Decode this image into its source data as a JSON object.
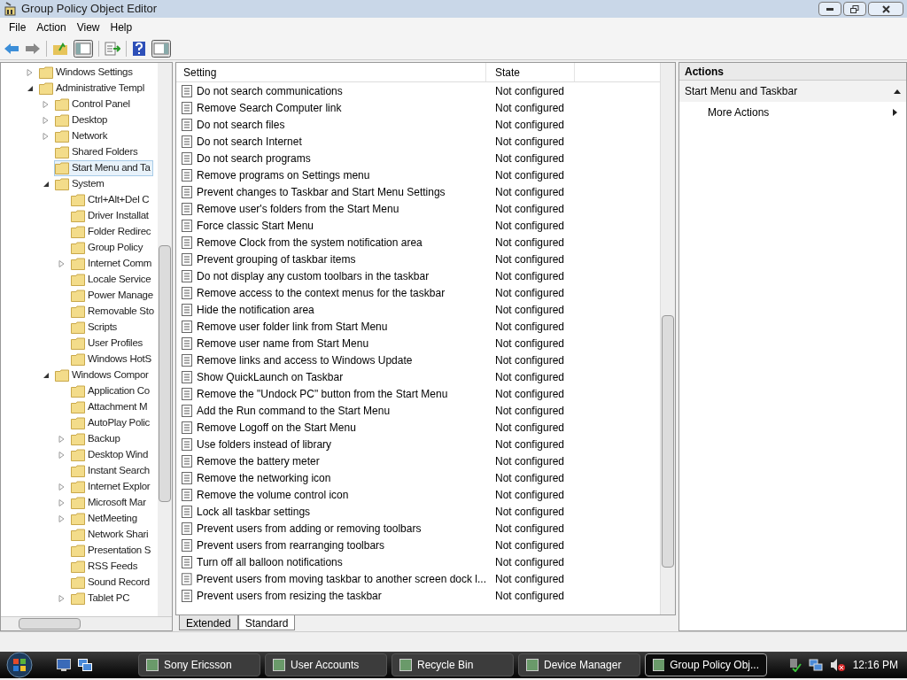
{
  "window": {
    "title": "Group Policy Object Editor"
  },
  "menu": [
    "File",
    "Action",
    "View",
    "Help"
  ],
  "tree": [
    {
      "label": "Windows Settings",
      "kind": "branch",
      "expanded": false,
      "selected": false
    },
    {
      "label": "Administrative Templ",
      "kind": "branch",
      "expanded": true,
      "selected": false,
      "children": [
        {
          "label": "Control Panel",
          "kind": "branch",
          "expanded": false,
          "selected": false
        },
        {
          "label": "Desktop",
          "kind": "branch",
          "expanded": false,
          "selected": false
        },
        {
          "label": "Network",
          "kind": "branch",
          "expanded": false,
          "selected": false
        },
        {
          "label": "Shared Folders",
          "kind": "leaf",
          "selected": false
        },
        {
          "label": "Start Menu and Ta",
          "kind": "leaf",
          "selected": true
        },
        {
          "label": "System",
          "kind": "branch",
          "expanded": true,
          "selected": false,
          "children": [
            {
              "label": "Ctrl+Alt+Del C",
              "kind": "leaf",
              "selected": false
            },
            {
              "label": "Driver Installat",
              "kind": "leaf",
              "selected": false
            },
            {
              "label": "Folder Redirec",
              "kind": "leaf",
              "selected": false
            },
            {
              "label": "Group Policy",
              "kind": "leaf",
              "selected": false
            },
            {
              "label": "Internet Comm",
              "kind": "branch",
              "expanded": false,
              "selected": false
            },
            {
              "label": "Locale Service",
              "kind": "leaf",
              "selected": false
            },
            {
              "label": "Power Manage",
              "kind": "leaf",
              "selected": false
            },
            {
              "label": "Removable Sto",
              "kind": "leaf",
              "selected": false
            },
            {
              "label": "Scripts",
              "kind": "leaf",
              "selected": false
            },
            {
              "label": "User Profiles",
              "kind": "leaf",
              "selected": false
            },
            {
              "label": "Windows HotS",
              "kind": "leaf",
              "selected": false
            }
          ]
        },
        {
          "label": "Windows Compor",
          "kind": "branch",
          "expanded": true,
          "selected": false,
          "children": [
            {
              "label": "Application Co",
              "kind": "leaf",
              "selected": false
            },
            {
              "label": "Attachment M",
              "kind": "leaf",
              "selected": false
            },
            {
              "label": "AutoPlay Polic",
              "kind": "leaf",
              "selected": false
            },
            {
              "label": "Backup",
              "kind": "branch",
              "expanded": false,
              "selected": false
            },
            {
              "label": "Desktop Wind",
              "kind": "branch",
              "expanded": false,
              "selected": false
            },
            {
              "label": "Instant Search",
              "kind": "leaf",
              "selected": false
            },
            {
              "label": "Internet Explor",
              "kind": "branch",
              "expanded": false,
              "selected": false
            },
            {
              "label": "Microsoft Mar",
              "kind": "branch",
              "expanded": false,
              "selected": false
            },
            {
              "label": "NetMeeting",
              "kind": "branch",
              "expanded": false,
              "selected": false
            },
            {
              "label": "Network Shari",
              "kind": "leaf",
              "selected": false
            },
            {
              "label": "Presentation S",
              "kind": "leaf",
              "selected": false
            },
            {
              "label": "RSS Feeds",
              "kind": "leaf",
              "selected": false
            },
            {
              "label": "Sound Record",
              "kind": "leaf",
              "selected": false
            },
            {
              "label": "Tablet PC",
              "kind": "branch",
              "expanded": false,
              "selected": false
            }
          ]
        }
      ]
    }
  ],
  "table": {
    "columns": [
      "Setting",
      "State"
    ],
    "rows": [
      [
        "Do not search communications",
        "Not configured"
      ],
      [
        "Remove Search Computer link",
        "Not configured"
      ],
      [
        "Do not search files",
        "Not configured"
      ],
      [
        "Do not search Internet",
        "Not configured"
      ],
      [
        "Do not search programs",
        "Not configured"
      ],
      [
        "Remove programs on Settings menu",
        "Not configured"
      ],
      [
        "Prevent changes to Taskbar and Start Menu Settings",
        "Not configured"
      ],
      [
        "Remove user's folders from the Start Menu",
        "Not configured"
      ],
      [
        "Force classic Start Menu",
        "Not configured"
      ],
      [
        "Remove Clock from the system notification area",
        "Not configured"
      ],
      [
        "Prevent grouping of taskbar items",
        "Not configured"
      ],
      [
        "Do not display any custom toolbars in the taskbar",
        "Not configured"
      ],
      [
        "Remove access to the context menus for the taskbar",
        "Not configured"
      ],
      [
        "Hide the notification area",
        "Not configured"
      ],
      [
        "Remove user folder link from Start Menu",
        "Not configured"
      ],
      [
        "Remove user name from Start Menu",
        "Not configured"
      ],
      [
        "Remove links and access to Windows Update",
        "Not configured"
      ],
      [
        "Show QuickLaunch on Taskbar",
        "Not configured"
      ],
      [
        "Remove the \"Undock PC\" button from the Start Menu",
        "Not configured"
      ],
      [
        "Add the Run command to the Start Menu",
        "Not configured"
      ],
      [
        "Remove Logoff on the Start Menu",
        "Not configured"
      ],
      [
        "Use folders instead of library",
        "Not configured"
      ],
      [
        "Remove the battery meter",
        "Not configured"
      ],
      [
        "Remove the networking icon",
        "Not configured"
      ],
      [
        "Remove the volume control icon",
        "Not configured"
      ],
      [
        "Lock all taskbar settings",
        "Not configured"
      ],
      [
        "Prevent users from adding or removing toolbars",
        "Not configured"
      ],
      [
        "Prevent users from rearranging toolbars",
        "Not configured"
      ],
      [
        "Turn off all balloon notifications",
        "Not configured"
      ],
      [
        "Prevent users from moving taskbar to another screen dock l...",
        "Not configured"
      ],
      [
        "Prevent users from resizing the taskbar",
        "Not configured"
      ]
    ]
  },
  "view_tabs": [
    {
      "label": "Extended",
      "selected": false
    },
    {
      "label": "Standard",
      "selected": true
    }
  ],
  "actions": {
    "title": "Actions",
    "section": "Start Menu and Taskbar",
    "items": [
      "More Actions"
    ]
  },
  "taskbar": {
    "tasks": [
      {
        "label": "Sony Ericsson",
        "selected": false
      },
      {
        "label": "User Accounts",
        "selected": false
      },
      {
        "label": "Recycle Bin",
        "selected": false
      },
      {
        "label": "Device Manager",
        "selected": false
      },
      {
        "label": "Group Policy Obj...",
        "selected": true
      }
    ],
    "clock": "12:16 PM"
  }
}
